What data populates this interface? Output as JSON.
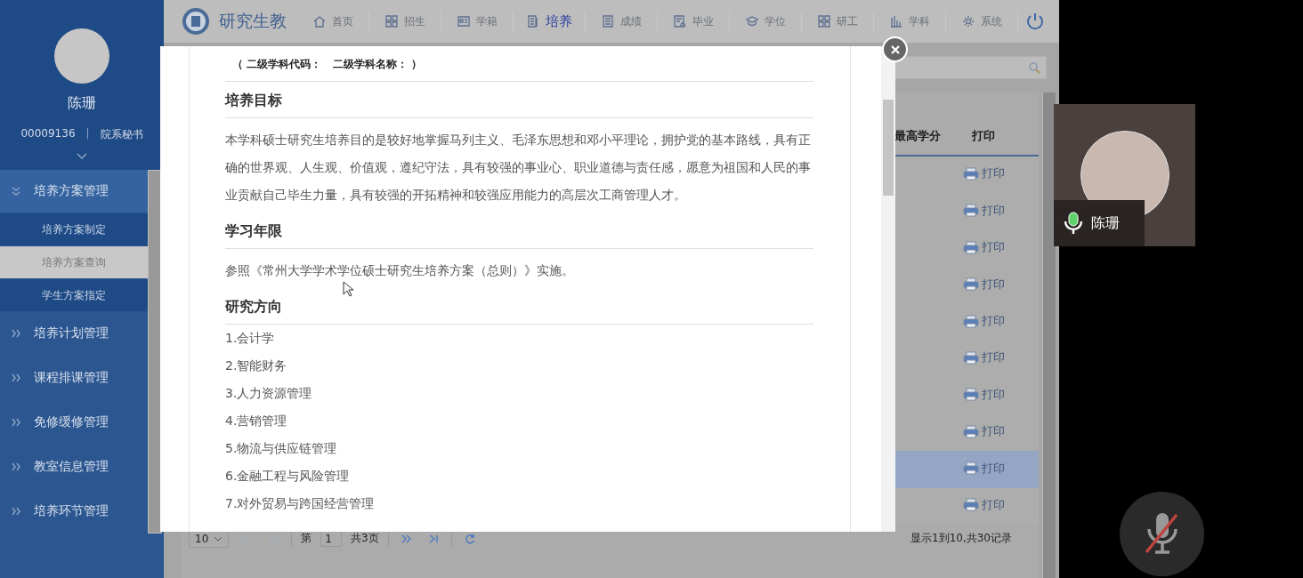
{
  "sidebar": {
    "user": {
      "name": "陈珊",
      "id": "00009136",
      "separator": "|",
      "role": "院系秘书"
    },
    "menu": [
      {
        "label": "培养方案管理",
        "expanded": true,
        "children": [
          {
            "label": "培养方案制定",
            "selected": false
          },
          {
            "label": "培养方案查询",
            "selected": true
          },
          {
            "label": "学生方案指定",
            "selected": false
          }
        ]
      },
      {
        "label": "培养计划管理",
        "expanded": false
      },
      {
        "label": "课程排课管理",
        "expanded": false
      },
      {
        "label": "免修缓修管理",
        "expanded": false
      },
      {
        "label": "教室信息管理",
        "expanded": false
      },
      {
        "label": "培养环节管理",
        "expanded": false
      }
    ]
  },
  "nav": {
    "brand": "研究生教",
    "items": [
      {
        "label": "首页",
        "selected": false
      },
      {
        "label": "招生",
        "selected": false
      },
      {
        "label": "学籍",
        "selected": false
      },
      {
        "label": "培养",
        "selected": true
      },
      {
        "label": "成绩",
        "selected": false
      },
      {
        "label": "毕业",
        "selected": false
      },
      {
        "label": "学位",
        "selected": false
      },
      {
        "label": "研工",
        "selected": false
      },
      {
        "label": "学科",
        "selected": false
      },
      {
        "label": "系统",
        "selected": false
      }
    ]
  },
  "table": {
    "columns": [
      "最高学分",
      "打印"
    ],
    "rows": [
      {
        "action": "打印",
        "selected": false
      },
      {
        "action": "打印",
        "selected": false
      },
      {
        "action": "打印",
        "selected": false
      },
      {
        "action": "打印",
        "selected": false
      },
      {
        "action": "打印",
        "selected": false
      },
      {
        "action": "打印",
        "selected": false
      },
      {
        "action": "打印",
        "selected": false
      },
      {
        "action": "打印",
        "selected": false
      },
      {
        "action": "打印",
        "selected": true
      },
      {
        "action": "打印",
        "selected": false
      }
    ]
  },
  "pagination": {
    "page_size": "10",
    "page_label": "第",
    "page": "1",
    "total_pages": "共3页",
    "summary": "显示1到10,共30记录"
  },
  "modal": {
    "subtitle": "（ 二级学科代码：   二级学科名称： ）",
    "sections": [
      {
        "heading": "培养目标",
        "kind": "paragraph",
        "text": "本学科硕士研究生培养目的是较好地掌握马列主义、毛泽东思想和邓小平理论，拥护党的基本路线，具有正确的世界观、人生观、价值观，遵纪守法，具有较强的事业心、职业道德与责任感，愿意为祖国和人民的事业贡献自己毕生力量，具有较强的开拓精神和较强应用能力的高层次工商管理人才。"
      },
      {
        "heading": "学习年限",
        "kind": "paragraph",
        "text": "参照《常州大学学术学位硕士研究生培养方案（总则）》实施。"
      },
      {
        "heading": "研究方向",
        "kind": "list",
        "items": [
          "1.会计学",
          "2.智能财务",
          "3.人力资源管理",
          "4.营销管理",
          "5.物流与供应链管理",
          "6.金融工程与风险管理",
          "7.对外贸易与跨国经营管理"
        ]
      }
    ]
  },
  "call": {
    "participant": {
      "name": "陈珊",
      "mic_on": true
    },
    "self_muted": true
  }
}
